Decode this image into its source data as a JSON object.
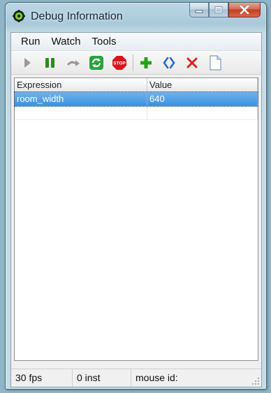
{
  "window": {
    "title": "Debug Information"
  },
  "menu": {
    "items": [
      "Run",
      "Watch",
      "Tools"
    ]
  },
  "toolbar": {
    "buttons": [
      {
        "icon": "play-icon",
        "enabled": false
      },
      {
        "icon": "pause-icon",
        "enabled": true
      },
      {
        "icon": "step-icon",
        "enabled": false
      },
      {
        "icon": "restart-icon",
        "enabled": true
      },
      {
        "icon": "stop-icon",
        "enabled": true,
        "text": "STOP"
      },
      {
        "icon": "add-watch-icon",
        "enabled": true
      },
      {
        "icon": "refresh-watch-icon",
        "enabled": true
      },
      {
        "icon": "delete-watch-icon",
        "enabled": true
      },
      {
        "icon": "clear-watch-icon",
        "enabled": true
      }
    ]
  },
  "watch_list": {
    "columns": [
      "Expression",
      "Value"
    ],
    "rows": [
      {
        "expression": "room_width",
        "value": "640",
        "selected": true
      }
    ]
  },
  "status": {
    "fps": "30 fps",
    "instances": "0 inst",
    "mouse": "mouse id:"
  },
  "colors": {
    "selection": "#3b8fde",
    "pause_green": "#2e8b1e",
    "stop_red": "#d8141a",
    "add_green": "#26a01b",
    "refresh_blue": "#2868d8",
    "delete_red": "#e0211f"
  }
}
